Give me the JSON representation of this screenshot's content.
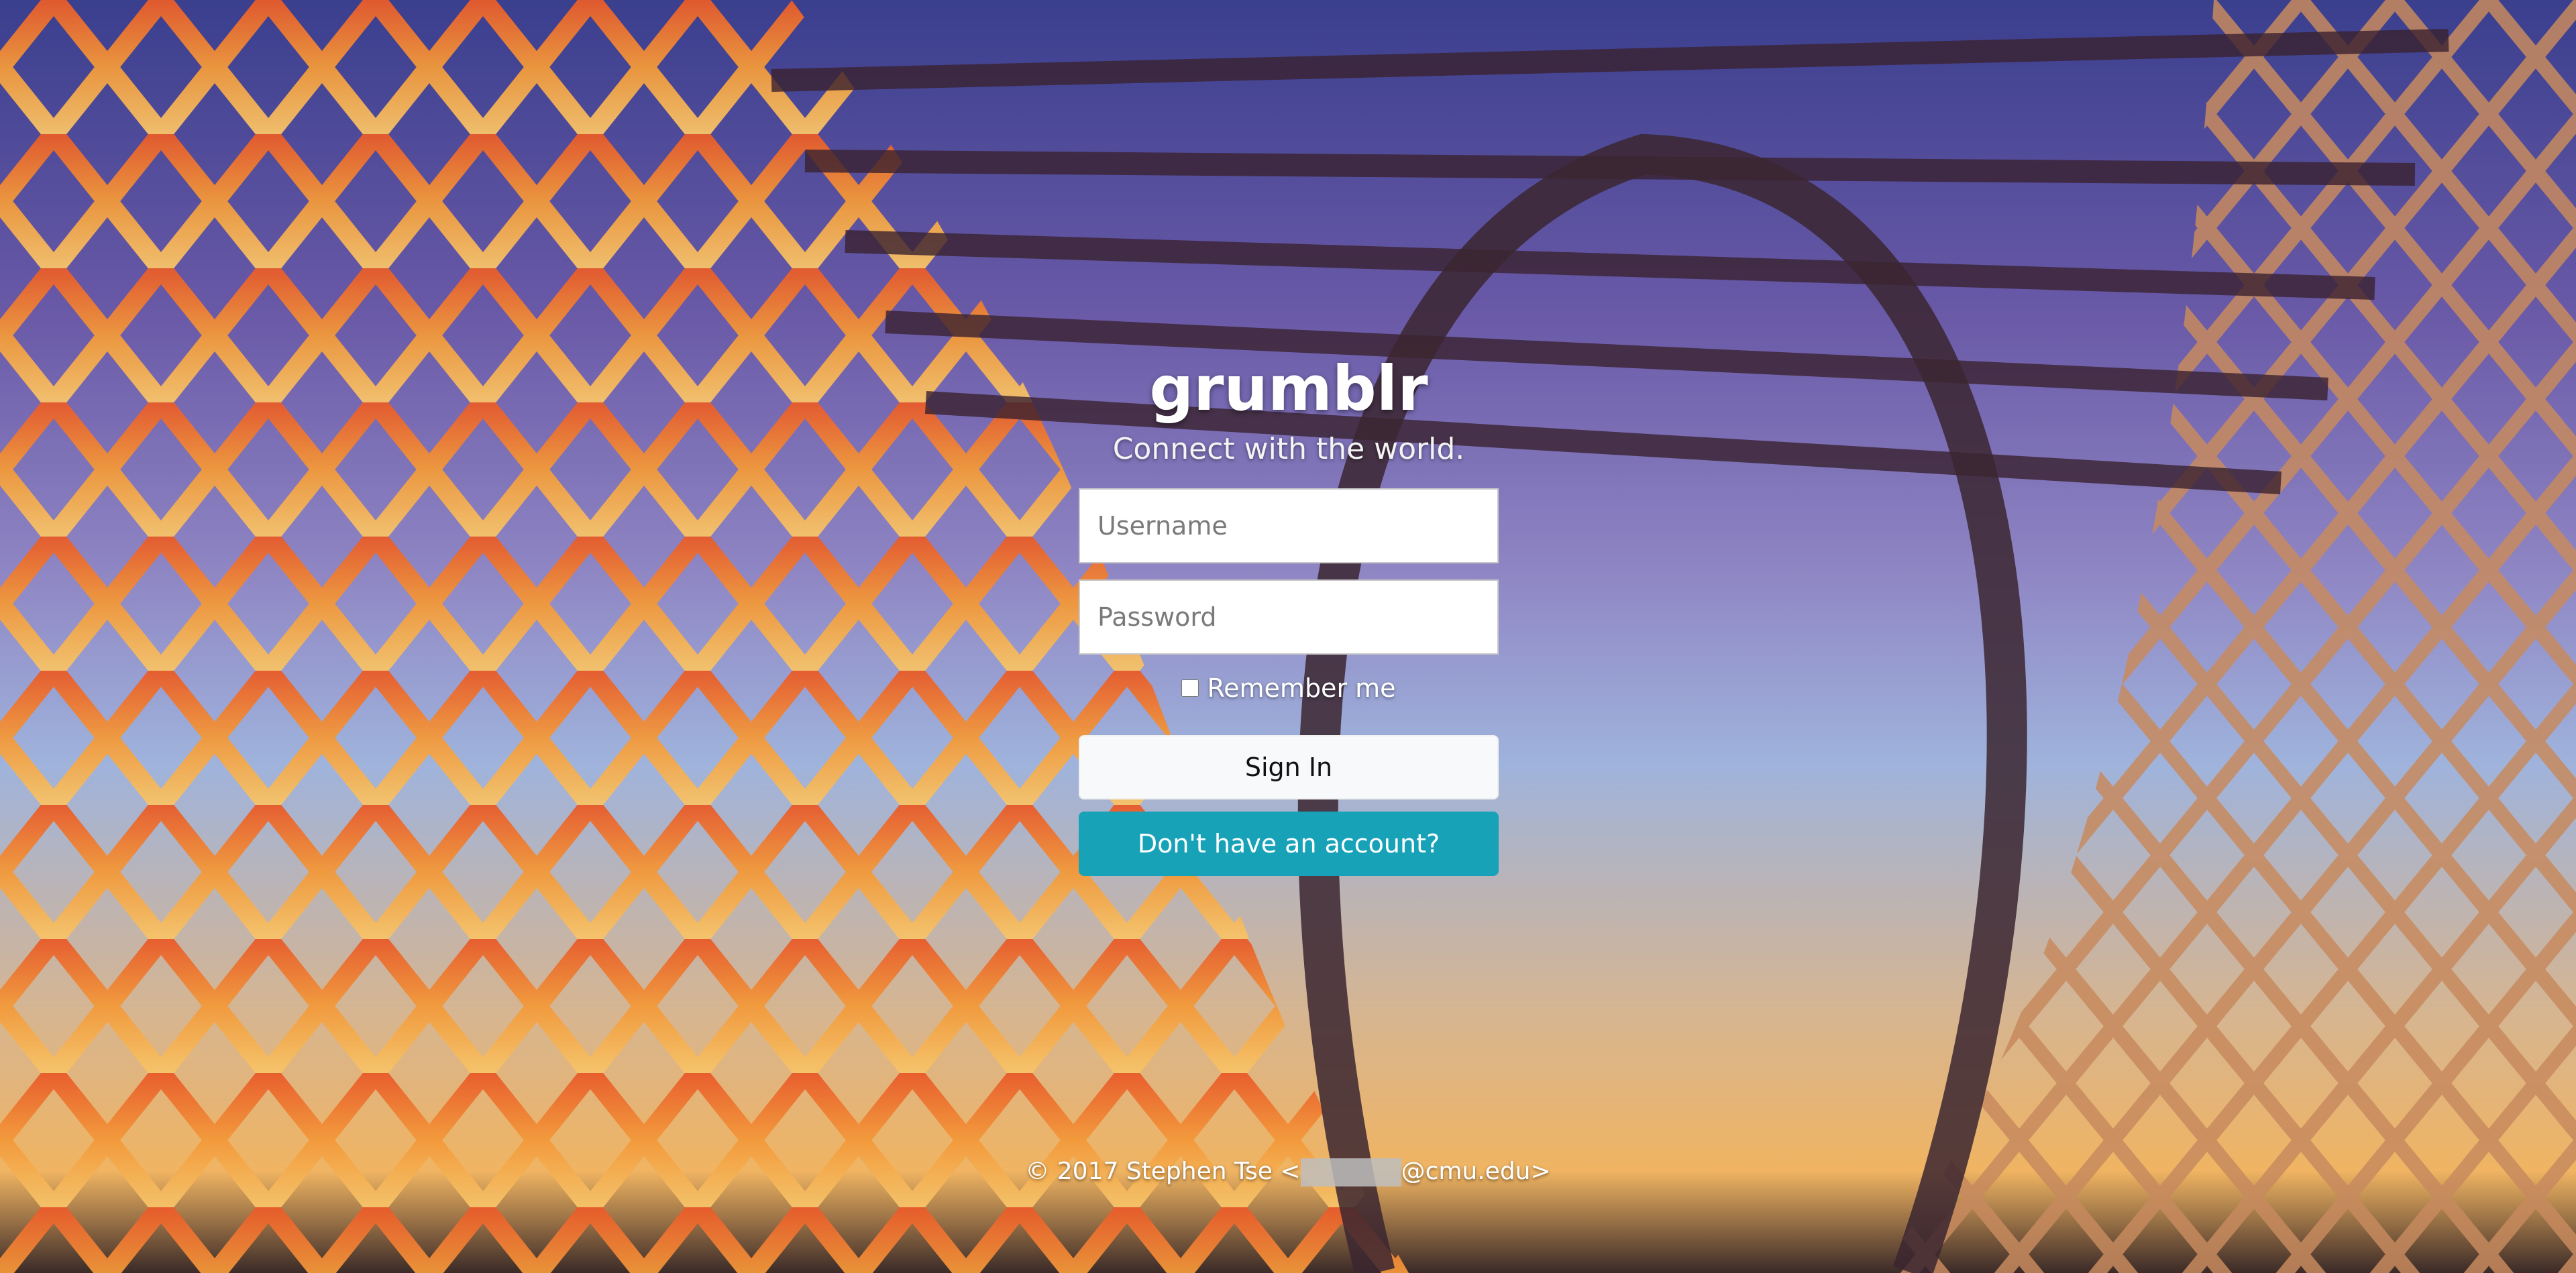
{
  "app": {
    "brand": "grumblr",
    "tagline": "Connect with the world."
  },
  "form": {
    "username_placeholder": "Username",
    "password_placeholder": "Password",
    "remember_label": "Remember me",
    "signin_label": "Sign In",
    "signup_label": "Don't have an account?"
  },
  "footer": {
    "prefix": "© 2017 Stephen Tse <",
    "suffix": "@cmu.edu>"
  },
  "colors": {
    "signup_button": "#17a2b8",
    "signin_button": "#f8f9fa"
  },
  "background": {
    "image": "arched-lattice-bridge-sunset-photo"
  }
}
